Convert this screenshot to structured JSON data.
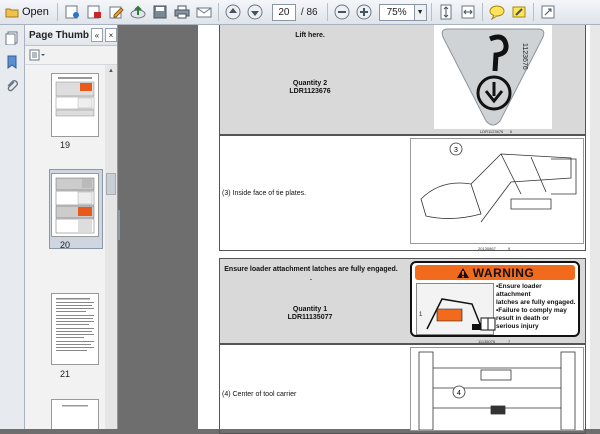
{
  "toolbar": {
    "open_label": "Open",
    "current_page": "20",
    "total_pages": "/ 86",
    "zoom": "75%",
    "icons": [
      "folder-open-icon",
      "print-to-pdf-icon",
      "pdf-doc-icon",
      "edit-icon",
      "upload-icon",
      "save-icon",
      "print-icon",
      "email-icon",
      "page-up-icon",
      "page-down-icon",
      "zoom-out-icon",
      "zoom-in-icon",
      "fit-page-icon",
      "fit-width-icon",
      "comment-icon",
      "highlight-icon",
      "expand-icon"
    ]
  },
  "panel": {
    "title": "Page Thumbna...",
    "thumbnails": [
      {
        "label": "19"
      },
      {
        "label": "20"
      },
      {
        "label": "21"
      }
    ]
  },
  "document": {
    "rows": [
      {
        "text": "Lift here.",
        "quantity": "Quantity 2",
        "part": "LDR1123676",
        "caption": "LDR1123676",
        "caption_num": "6",
        "decal_number": "1123676"
      },
      {
        "text": "(3) Inside face of tie plates.",
        "callout": "3",
        "caption": "20130867",
        "caption_num": "9"
      },
      {
        "text": "Ensure loader attachment latches are fully engaged.",
        "dot": ".",
        "quantity": "Quantity 1",
        "part": "LDR11135077",
        "caption": "11135076",
        "caption_num": "7",
        "warning": {
          "title": "WARNING",
          "lines": [
            "•Ensure loader attachment",
            "latches are fully engaged.",
            "•Failure to comply may",
            "result in death or",
            "serious injury"
          ],
          "marker": "1"
        }
      },
      {
        "text": "(4) Center of tool carrier",
        "callout": "4"
      }
    ]
  }
}
